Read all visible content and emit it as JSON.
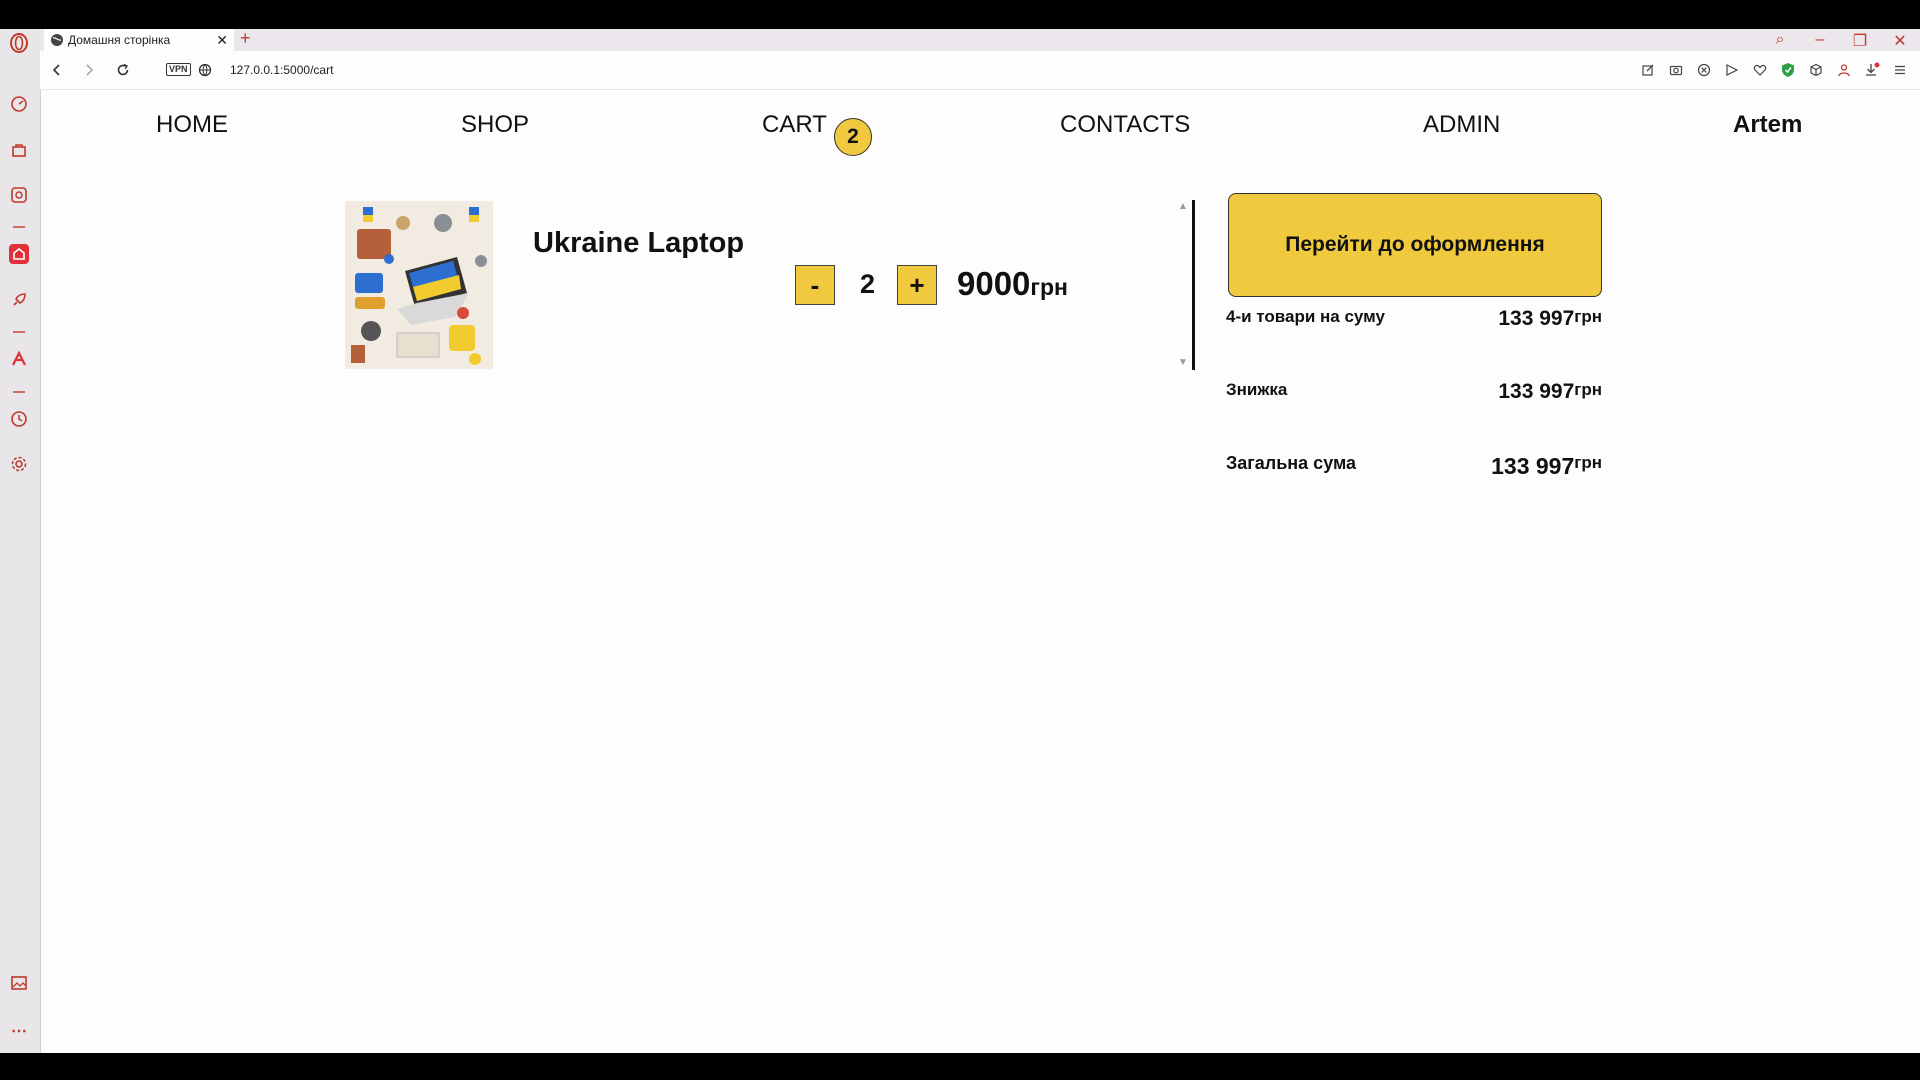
{
  "browser": {
    "tab_title": "Домашня сторінка",
    "url": "127.0.0.1:5000/cart",
    "vpn_label": "VPN",
    "accent_color": "#c0392b"
  },
  "nav": {
    "home": "HOME",
    "shop": "SHOP",
    "cart": "CART",
    "cart_count": "2",
    "contacts": "CONTACTS",
    "admin": "ADMIN",
    "user": "Artem"
  },
  "cart": {
    "items": [
      {
        "title": "Ukraine Laptop",
        "minus_label": "-",
        "quantity": "2",
        "plus_label": "+",
        "price": "9000",
        "currency": "грн"
      }
    ]
  },
  "summary": {
    "checkout_label": "Перейти до оформлення",
    "items_label": "4-и товари на суму",
    "items_value": "133 997",
    "discount_label": "Знижка",
    "discount_value": "133 997",
    "total_label": "Загальна сума",
    "total_value": "133 997",
    "currency": "грн"
  },
  "colors": {
    "accent_yellow": "#f0c93e",
    "text": "#111111"
  }
}
